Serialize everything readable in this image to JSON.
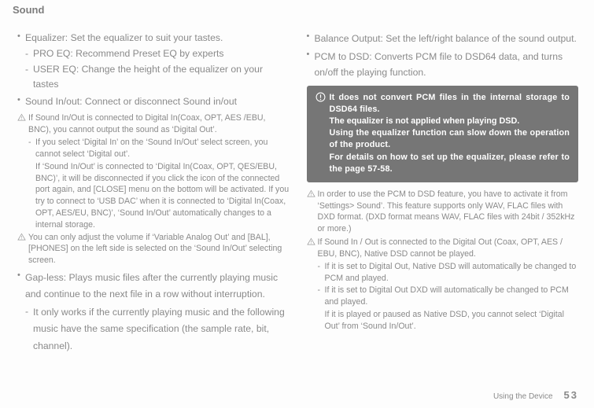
{
  "title": "Sound",
  "left": {
    "eq_main": "Equalizer: Set the equalizer to suit your tastes.",
    "eq_pro": "PRO EQ: Recommend Preset EQ by experts",
    "eq_user": "USER EQ: Change the height of the equalizer on your tastes",
    "sio_main": "Sound In/out: Connect or disconnect Sound in/out",
    "w1_main": "If Sound In/Out is connected to Digital In(Coax, OPT, AES /EBU, BNC), you cannot output the sound as ‘Digital Out’.",
    "w1_sub": "If you select ‘Digital In’ on the ‘Sound In/Out’ select screen, you cannot select ‘Digital out’.",
    "w1_p1": "If ‘Sound In/Out’ is connected to ‘Digital In(Coax, OPT, QES/EBU, BNC)’, it will be disconnected if you click the icon of the connected port again, and [CLOSE] menu on the bottom will be activated. If you try to connect to ‘USB DAC’ when it is connected to ‘Digital In(Coax, OPT, AES/EU, BNC)’, ‘Sound In/Out’ automatically changes to a internal storage.",
    "w2_main": "You can only adjust the volume if ‘Variable Analog Out’ and [BAL], [PHONES] on the left side is selected on the ‘Sound In/Out’ selecting screen.",
    "gapless_main": "Gap-less: Plays music files after the currently playing music and continue to the next file in a row without interruption.",
    "gapless_sub": "It only works if the currently playing music and the following music have the same specification (the sample rate, bit, channel)."
  },
  "right": {
    "balance": "Balance Output: Set the left/right balance of the sound output.",
    "pcm": "PCM to DSD: Converts PCM file to DSD64 data, and turns on/off the playing function.",
    "note_l1": "It does not convert PCM files in the internal storage to DSD64 files.",
    "note_l2": "The equalizer is not applied when playing DSD.",
    "note_l3": "Using the equalizer function can slow down the operation of the product.",
    "note_l4": "For details on how to set up the equalizer, please refer to the page 57-58.",
    "w3": "In order to use the PCM to DSD feature, you have to activate it from ‘Settings> Sound’. This feature supports only WAV, FLAC files with DXD format. (DXD format means WAV, FLAC files with 24bit / 352kHz or more.)",
    "w4_main": "If Sound In / Out is connected to the Digital Out (Coax, OPT, AES / EBU, BNC), Native DSD cannot be played.",
    "w4_s1": "If it is set to Digital Out, Native DSD will automatically be changed to PCM and played.",
    "w4_s2": "If it is set to Digital Out DXD will automatically be changed to PCM and played.",
    "w4_p": "If it is played or paused as Native DSD, you cannot select ‘Digital Out’ from ‘Sound In/Out’."
  },
  "footer": {
    "section": "Using the Device",
    "page": "53"
  }
}
